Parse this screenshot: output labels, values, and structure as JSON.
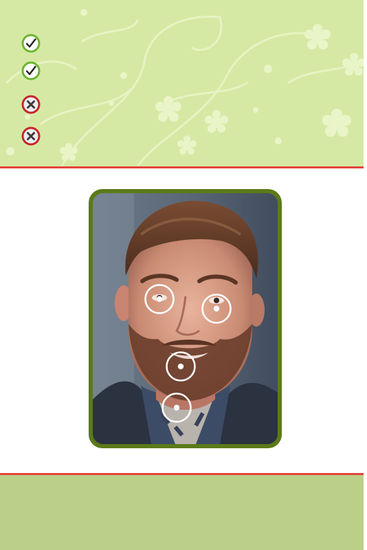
{
  "checklist": {
    "items": [
      {
        "status": "pass",
        "icon": "check-icon",
        "label": ""
      },
      {
        "status": "pass",
        "icon": "check-icon",
        "label": ""
      },
      {
        "status": "fail",
        "icon": "cross-icon",
        "label": ""
      },
      {
        "status": "fail",
        "icon": "cross-icon",
        "label": ""
      }
    ]
  },
  "face_landmarks": [
    "left-eye",
    "right-eye",
    "nose",
    "chin"
  ],
  "colors": {
    "header_bg": "#d6e9a4",
    "pattern": "#e8f4c6",
    "divider": "#e3433a",
    "frame": "#5b7a18",
    "footer_bg": "#bccf89",
    "pass_green": "#5fa82a",
    "fail_red": "#c8242b"
  }
}
